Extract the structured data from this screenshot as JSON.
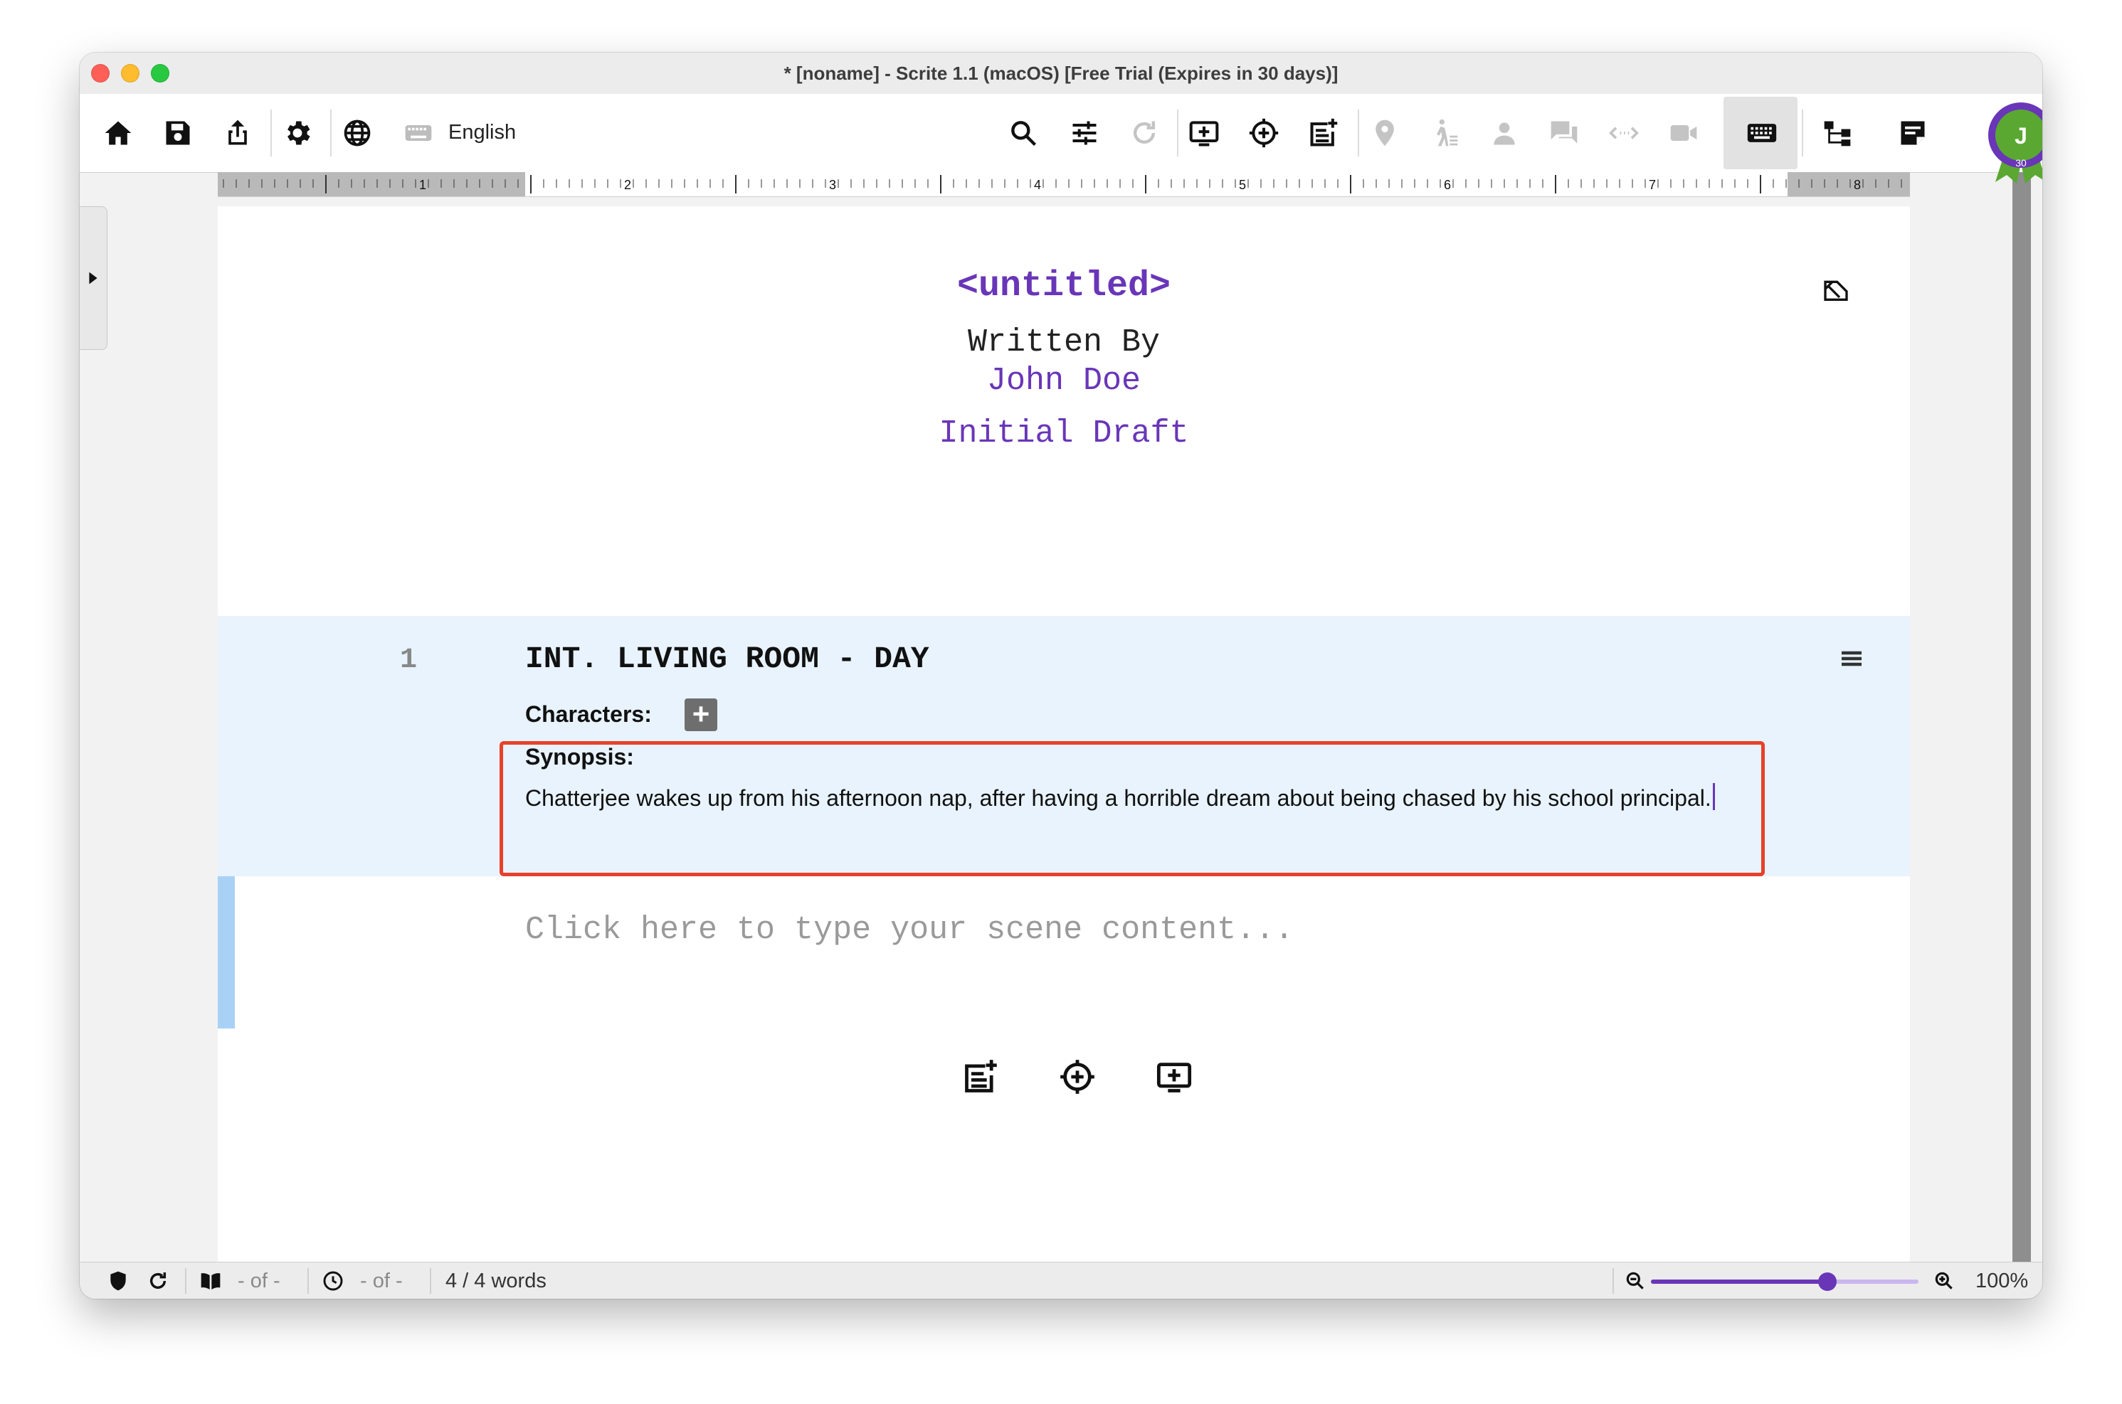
{
  "window": {
    "title": "* [noname] - Scrite 1.1 (macOS) [Free Trial (Expires in 30 days)]",
    "traffic_colors": [
      "#ff5f57",
      "#febc2e",
      "#28c840"
    ]
  },
  "toolbar": {
    "language": "English",
    "icons": [
      "home-icon",
      "save-icon",
      "share-icon",
      "settings-icon",
      "globe-icon",
      "keyboard-icon",
      "search-icon",
      "sliders-icon",
      "redo-icon",
      "add-scene-icon",
      "add-mark-icon",
      "add-note-icon",
      "location-icon",
      "action-icon",
      "character-icon",
      "dialogue-icon",
      "transition-icon",
      "shot-icon",
      "grid-icon",
      "keyboard-tab-icon",
      "structure-tab-icon",
      "notebook-tab-icon"
    ]
  },
  "user": {
    "initial": "J",
    "badge": "30",
    "ring_color": "#6936b8",
    "fill_color": "#5aa832"
  },
  "ruler": {
    "labels": [
      "1",
      "2",
      "3",
      "4",
      "5",
      "6",
      "7",
      "8"
    ]
  },
  "title_page": {
    "title": "<untitled>",
    "written_by": "Written By",
    "author": "John Doe",
    "version": "Initial Draft"
  },
  "scene": {
    "number": "1",
    "heading": "INT. LIVING ROOM - DAY",
    "characters_label": "Characters:",
    "add_character": "+",
    "synopsis_label": "Synopsis:",
    "synopsis_text": "Chatterjee wakes up from his afternoon nap, after having a horrible dream about being chased by his school principal."
  },
  "editor": {
    "content_placeholder": "Click here to type your scene content..."
  },
  "status": {
    "page_info": "- of -",
    "time_info": "- of -",
    "word_count": "4 / 4 words",
    "zoom": "100%",
    "zoom_fraction": 0.66
  },
  "colors": {
    "accent": "#6936b8",
    "scene_bg": "#e8f3fe",
    "scene_bar": "#a9d1f6",
    "highlight": "#e8402a"
  }
}
